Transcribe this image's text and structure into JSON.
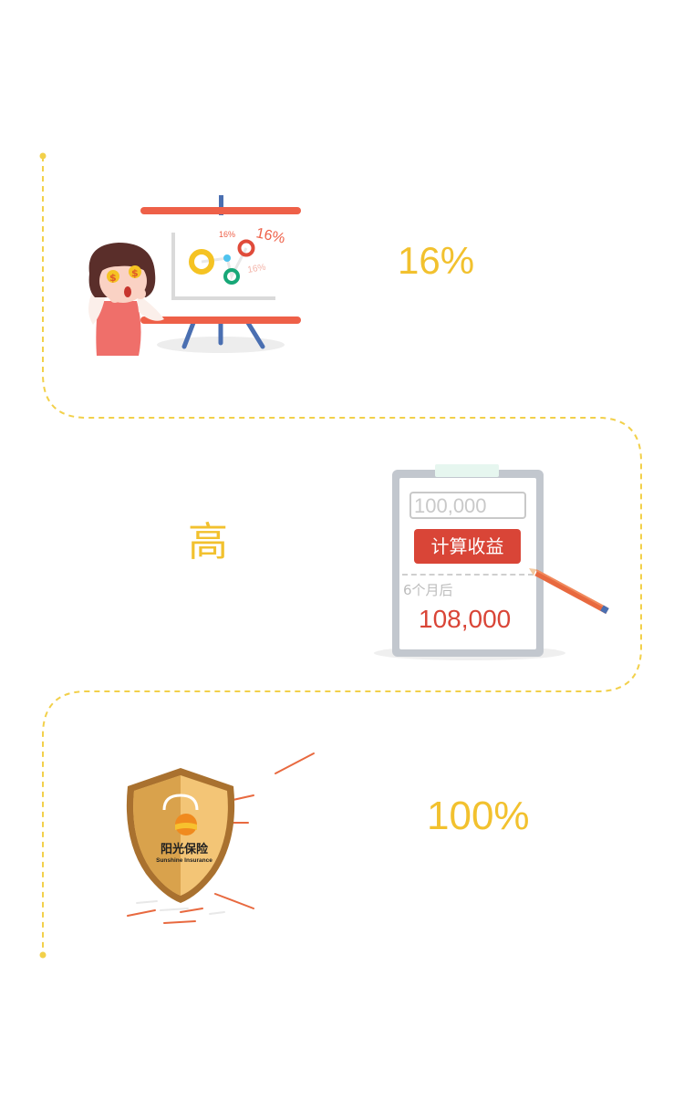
{
  "sections": [
    {
      "stat_text": "16%",
      "illustration": {
        "chart_labels": [
          "16%",
          "16%",
          "16%"
        ],
        "eye_symbols": [
          "$",
          "$"
        ]
      }
    },
    {
      "stat_text": "高",
      "illustration": {
        "input_value": "100,000",
        "button_label": "计算收益",
        "period_label": "6个月后",
        "result_value": "108,000"
      }
    },
    {
      "stat_text": "100%",
      "illustration": {
        "brand_name": "阳光保险",
        "brand_name_en": "Sunshine Insurance"
      }
    }
  ],
  "colors": {
    "accent_yellow": "#F2C12E",
    "red": "#E04B3A",
    "board_red": "#EE6048",
    "stand_blue": "#4A6FB1",
    "green": "#17A777",
    "track_line": "#F2D04A"
  }
}
